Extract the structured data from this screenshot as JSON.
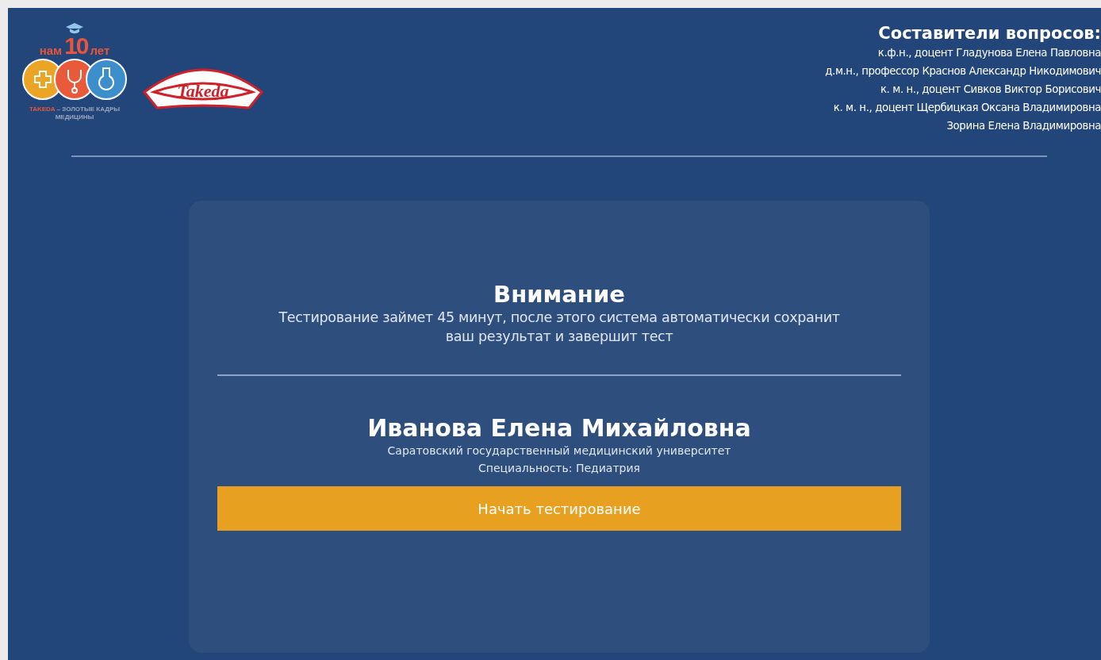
{
  "logo_anniversary": {
    "top_left": "нам",
    "number": "10",
    "top_right": "лет",
    "brand": "TAKEDA",
    "tagline": "– ЗОЛОТЫЕ КАДРЫ",
    "tagline_2": "МЕДИЦИНЫ"
  },
  "logo_brand": {
    "text": "Takeda"
  },
  "authors": {
    "title": "Составители вопросов:",
    "names": [
      "к.ф.н., доцент Гладунова Елена Павловна",
      "д.м.н., профессор Краснов Александр Никодимович",
      "к. м. н., доцент Сивков Виктор Борисович",
      "к. м. н., доцент Щербицкая Оксана Владимировна",
      "Зорина Елена Владимировна"
    ]
  },
  "notice": {
    "title": "Внимание",
    "text": "Тестирование займет 45 минут, после этого система автоматически сохранит ваш результат и завершит тест"
  },
  "participant": {
    "name": "Иванова Елена Михайловна",
    "university": "Саратовский государственный медицинский университет",
    "specialty": "Специальность: Педиатрия"
  },
  "start_button": "Начать тестирование"
}
